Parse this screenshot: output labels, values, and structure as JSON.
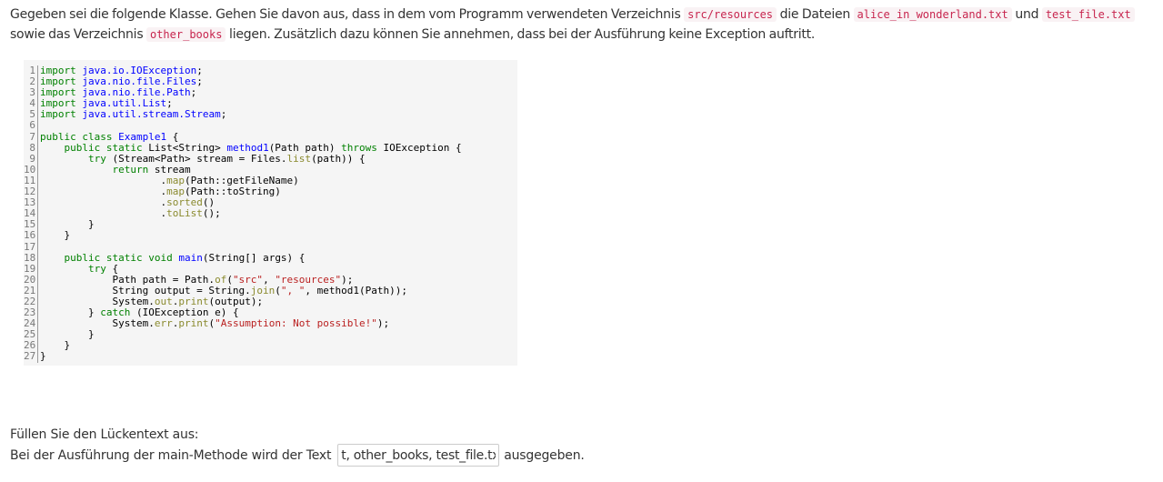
{
  "intro": {
    "t1": "Gegeben sei die folgende Klasse. Gehen Sie davon aus, dass in dem vom Programm verwendeten Verzeichnis ",
    "code1": "src/resources",
    "t2": " die Dateien ",
    "code2": "alice_in_wonderland.txt",
    "t3": " und ",
    "code3": "test_file.txt",
    "t4": " sowie das Verzeichnis ",
    "code4": "other_books",
    "t5": " liegen. Zusätzlich dazu können Sie annehmen, dass bei der Ausführung keine Exception auftritt."
  },
  "code_lines": [
    {
      "n": "1",
      "tokens": [
        [
          "kw",
          "import"
        ],
        [
          "pun",
          " "
        ],
        [
          "pkg",
          "java.io.IOException"
        ],
        [
          "pun",
          ";"
        ]
      ]
    },
    {
      "n": "2",
      "tokens": [
        [
          "kw",
          "import"
        ],
        [
          "pun",
          " "
        ],
        [
          "pkg",
          "java.nio.file.Files"
        ],
        [
          "pun",
          ";"
        ]
      ]
    },
    {
      "n": "3",
      "tokens": [
        [
          "kw",
          "import"
        ],
        [
          "pun",
          " "
        ],
        [
          "pkg",
          "java.nio.file.Path"
        ],
        [
          "pun",
          ";"
        ]
      ]
    },
    {
      "n": "4",
      "tokens": [
        [
          "kw",
          "import"
        ],
        [
          "pun",
          " "
        ],
        [
          "pkg",
          "java.util.List"
        ],
        [
          "pun",
          ";"
        ]
      ]
    },
    {
      "n": "5",
      "tokens": [
        [
          "kw",
          "import"
        ],
        [
          "pun",
          " "
        ],
        [
          "pkg",
          "java.util.stream.Stream"
        ],
        [
          "pun",
          ";"
        ]
      ]
    },
    {
      "n": "6",
      "tokens": []
    },
    {
      "n": "7",
      "tokens": [
        [
          "kw",
          "public class"
        ],
        [
          "pun",
          " "
        ],
        [
          "cls",
          "Example1"
        ],
        [
          "pun",
          " {"
        ]
      ]
    },
    {
      "n": "8",
      "tokens": [
        [
          "pun",
          "    "
        ],
        [
          "kw",
          "public static"
        ],
        [
          "pun",
          " List"
        ],
        [
          "gen",
          "<String>"
        ],
        [
          "pun",
          " "
        ],
        [
          "fn",
          "method1"
        ],
        [
          "pun",
          "(Path path) "
        ],
        [
          "kw",
          "throws"
        ],
        [
          "pun",
          " IOException {"
        ]
      ]
    },
    {
      "n": "9",
      "tokens": [
        [
          "pun",
          "        "
        ],
        [
          "kw",
          "try"
        ],
        [
          "pun",
          " (Stream"
        ],
        [
          "gen",
          "<Path>"
        ],
        [
          "pun",
          " stream = Files."
        ],
        [
          "call",
          "list"
        ],
        [
          "pun",
          "(path)) {"
        ]
      ]
    },
    {
      "n": "10",
      "tokens": [
        [
          "pun",
          "            "
        ],
        [
          "kw",
          "return"
        ],
        [
          "pun",
          " stream"
        ]
      ]
    },
    {
      "n": "11",
      "tokens": [
        [
          "pun",
          "                    ."
        ],
        [
          "call",
          "map"
        ],
        [
          "pun",
          "(Path::getFileName)"
        ]
      ]
    },
    {
      "n": "12",
      "tokens": [
        [
          "pun",
          "                    ."
        ],
        [
          "call",
          "map"
        ],
        [
          "pun",
          "(Path::toString)"
        ]
      ]
    },
    {
      "n": "13",
      "tokens": [
        [
          "pun",
          "                    ."
        ],
        [
          "call",
          "sorted"
        ],
        [
          "pun",
          "()"
        ]
      ]
    },
    {
      "n": "14",
      "tokens": [
        [
          "pun",
          "                    ."
        ],
        [
          "call",
          "toList"
        ],
        [
          "pun",
          "();"
        ]
      ]
    },
    {
      "n": "15",
      "tokens": [
        [
          "pun",
          "        }"
        ]
      ]
    },
    {
      "n": "16",
      "tokens": [
        [
          "pun",
          "    }"
        ]
      ]
    },
    {
      "n": "17",
      "tokens": []
    },
    {
      "n": "18",
      "tokens": [
        [
          "pun",
          "    "
        ],
        [
          "kw",
          "public static void"
        ],
        [
          "pun",
          " "
        ],
        [
          "fn",
          "main"
        ],
        [
          "pun",
          "(String[] args) {"
        ]
      ]
    },
    {
      "n": "19",
      "tokens": [
        [
          "pun",
          "        "
        ],
        [
          "kw",
          "try"
        ],
        [
          "pun",
          " {"
        ]
      ]
    },
    {
      "n": "20",
      "tokens": [
        [
          "pun",
          "            Path path = Path."
        ],
        [
          "call",
          "of"
        ],
        [
          "pun",
          "("
        ],
        [
          "str",
          "\"src\""
        ],
        [
          "pun",
          ", "
        ],
        [
          "str",
          "\"resources\""
        ],
        [
          "pun",
          ");"
        ]
      ]
    },
    {
      "n": "21",
      "tokens": [
        [
          "pun",
          "            String output = String."
        ],
        [
          "call",
          "join"
        ],
        [
          "pun",
          "("
        ],
        [
          "str",
          "\", \""
        ],
        [
          "pun",
          ", method1(Path));"
        ]
      ]
    },
    {
      "n": "22",
      "tokens": [
        [
          "pun",
          "            System."
        ],
        [
          "call",
          "out"
        ],
        [
          "pun",
          "."
        ],
        [
          "call",
          "print"
        ],
        [
          "pun",
          "(output);"
        ]
      ]
    },
    {
      "n": "23",
      "tokens": [
        [
          "pun",
          "        } "
        ],
        [
          "kw",
          "catch"
        ],
        [
          "pun",
          " (IOException e) {"
        ]
      ]
    },
    {
      "n": "24",
      "tokens": [
        [
          "pun",
          "            System."
        ],
        [
          "call",
          "err"
        ],
        [
          "pun",
          "."
        ],
        [
          "call",
          "print"
        ],
        [
          "pun",
          "("
        ],
        [
          "str",
          "\"Assumption: Not possible!\""
        ],
        [
          "pun",
          ");"
        ]
      ]
    },
    {
      "n": "25",
      "tokens": [
        [
          "pun",
          "        }"
        ]
      ]
    },
    {
      "n": "26",
      "tokens": [
        [
          "pun",
          "    }"
        ]
      ]
    },
    {
      "n": "27",
      "tokens": [
        [
          "pun",
          "}"
        ]
      ]
    }
  ],
  "prompt": "Füllen Sie den Lückentext aus:",
  "answer": {
    "before": "Bei der Ausführung der main-Methode wird der Text",
    "value": "t, other_books, test_file.txt",
    "after": "ausgegeben."
  }
}
